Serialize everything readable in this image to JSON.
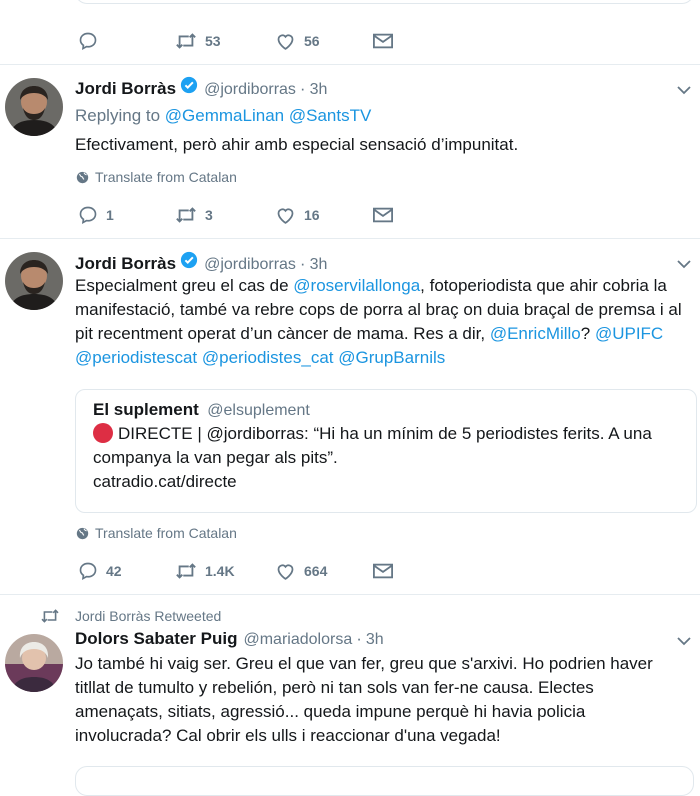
{
  "top_actions": {
    "reply_count": "",
    "retweet_count": "53",
    "like_count": "56"
  },
  "tweet1": {
    "name": "Jordi Borràs",
    "handle": "@jordiborras",
    "time": "3h",
    "replying_prefix": "Replying to",
    "replying_to": [
      "@GemmaLinan",
      "@SantsTV"
    ],
    "text": "Efectivament, però ahir amb especial sensació d’impunitat.",
    "translate_label": "Translate from Catalan",
    "reply_count": "1",
    "retweet_count": "3",
    "like_count": "16"
  },
  "tweet2": {
    "name": "Jordi Borràs",
    "handle": "@jordiborras",
    "time": "3h",
    "text_parts": {
      "p1": "Especialment greu el cas de ",
      "m1": "@roservilallonga",
      "p2": ", fotoperiodista que ahir cobria la manifestació, també va rebre cops de porra al braç on duia braçal de premsa i al pit recentment operat d’un càncer de mama. Res a dir, ",
      "m2": "@EnricMillo",
      "p3": "? ",
      "m3": "@UPIFC",
      "m4": "@periodistescat",
      "m5": "@periodistes_cat",
      "m6": "@GrupBarnils"
    },
    "quote": {
      "name": "El suplement",
      "handle": "@elsuplement",
      "text": "DIRECTE | @jordiborras: “Hi ha un mínim de 5 periodistes ferits. A una companya la van pegar als pits”.",
      "link": "catradio.cat/directe"
    },
    "translate_label": "Translate from Catalan",
    "reply_count": "42",
    "retweet_count": "1.4K",
    "like_count": "664"
  },
  "tweet3": {
    "retweeted_by": "Jordi Borràs Retweeted",
    "name": "Dolors Sabater Puig",
    "handle": "@mariadolorsa",
    "time": "3h",
    "text": "Jo també hi vaig ser. Greu el que van fer, greu que s'arxivi. Ho podrien haver titllat de tumulto y rebelión, però ni tan sols van fer-ne causa. Electes amenaçats, sitiats, agressió... queda impune perquè hi havia policia involucrada? Cal obrir els ulls i reaccionar d'una vegada!"
  },
  "separator": "·",
  "colors": {
    "link": "#1b95e0",
    "muted": "#657786",
    "verified": "#1da1f2",
    "live": "#dd2e44"
  }
}
